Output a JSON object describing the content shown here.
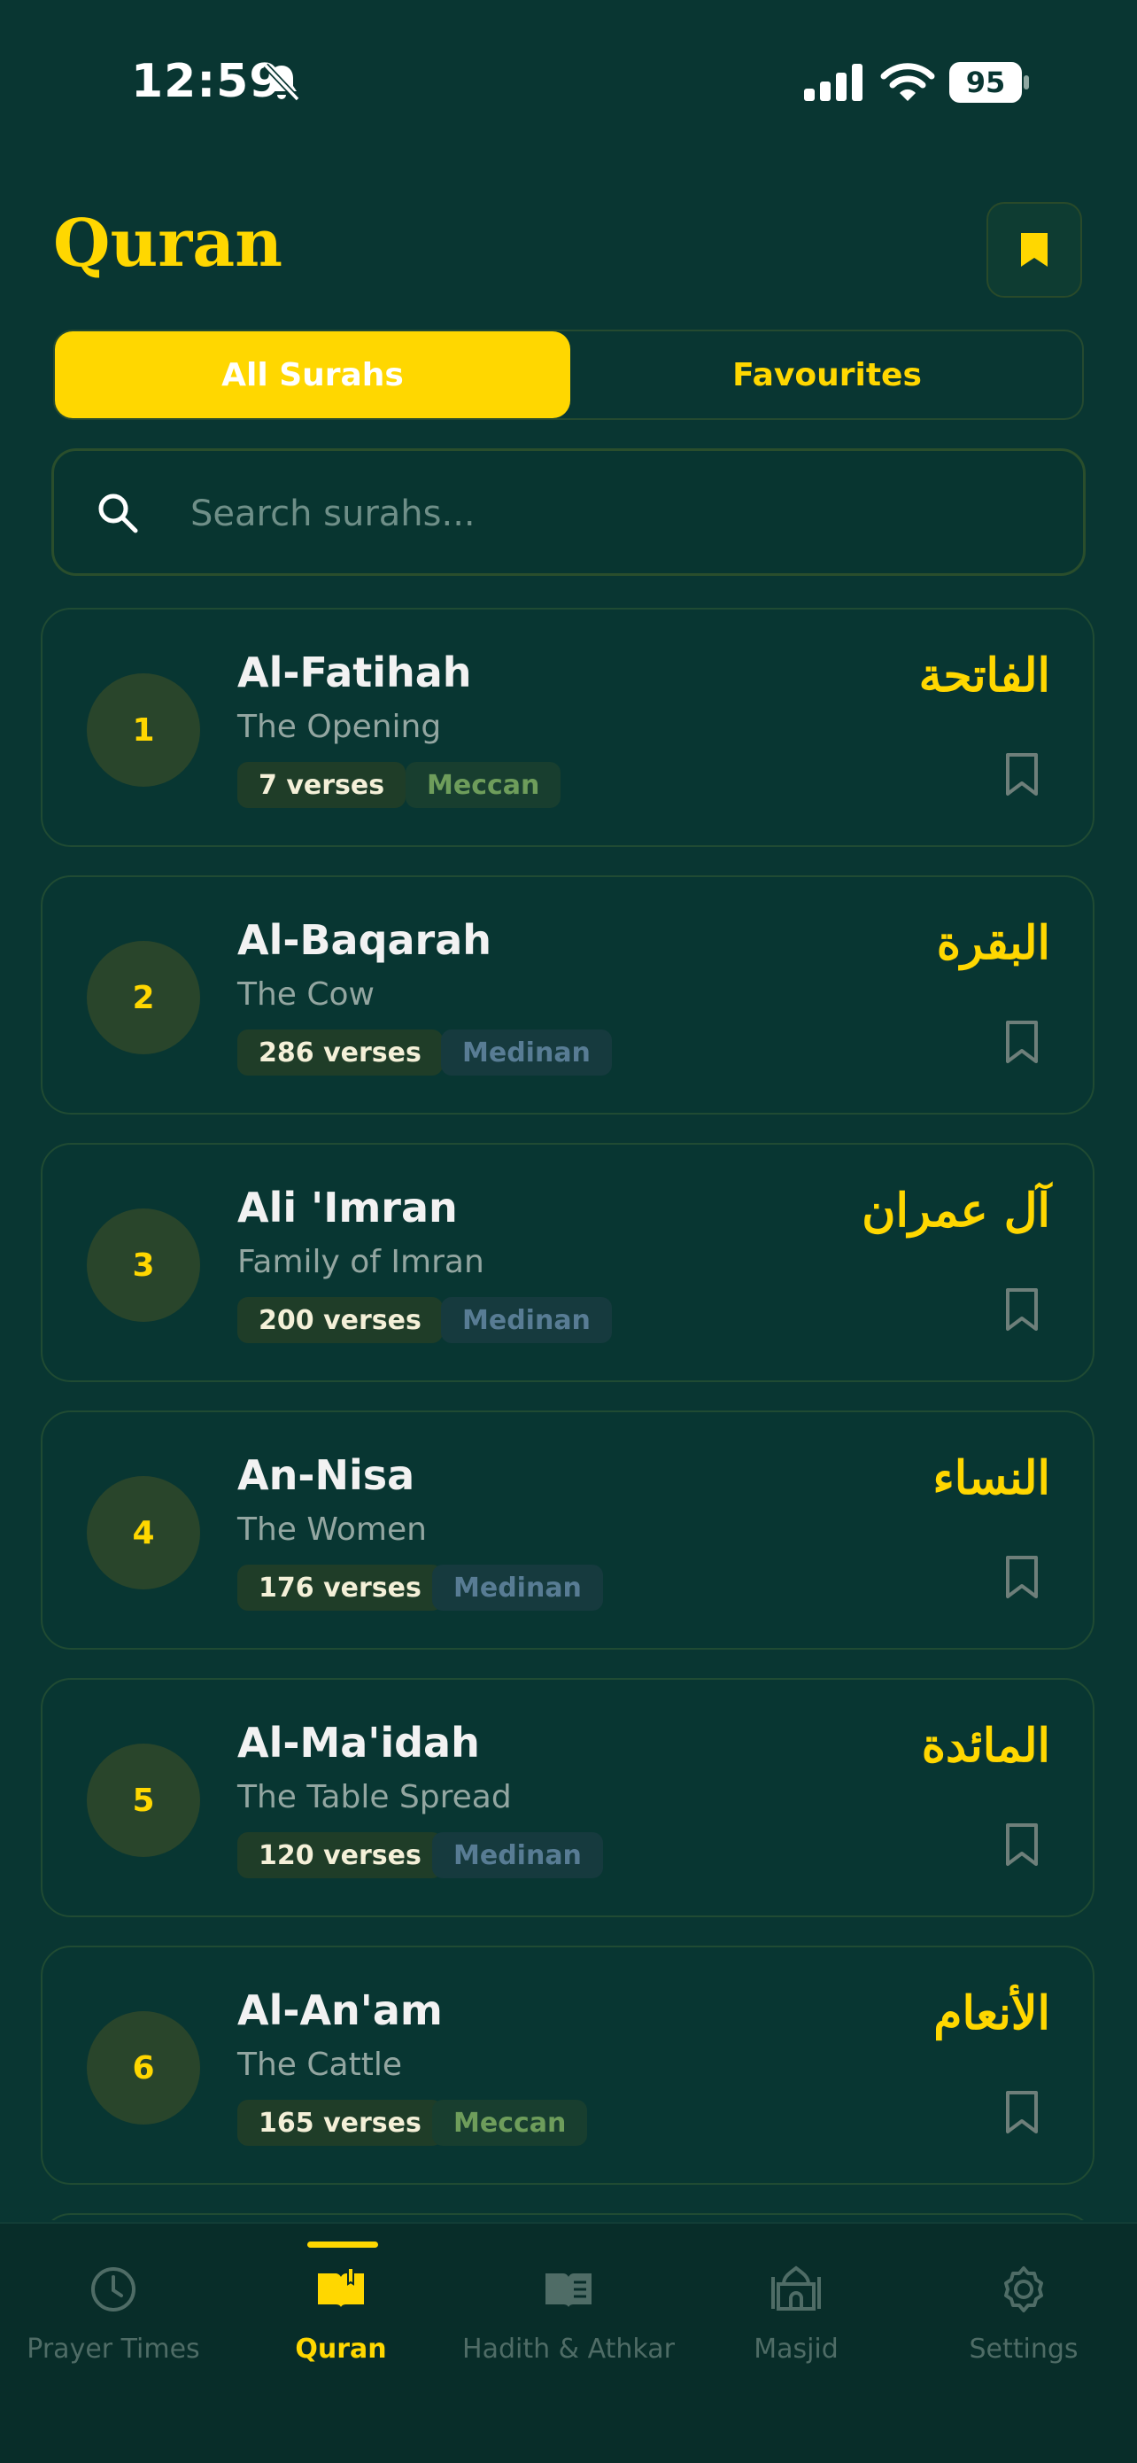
{
  "status": {
    "time": "12:59",
    "battery": "95"
  },
  "header": {
    "title": "Quran"
  },
  "tabs": [
    {
      "label": "All Surahs"
    },
    {
      "label": "Favourites"
    }
  ],
  "search": {
    "placeholder": "Search surahs..."
  },
  "surahs": [
    {
      "number": "1",
      "name": "Al-Fatihah",
      "meaning": "The Opening",
      "verses": "7 verses",
      "type": "Meccan",
      "arabic": "الفاتحة"
    },
    {
      "number": "2",
      "name": "Al-Baqarah",
      "meaning": "The Cow",
      "verses": "286 verses",
      "type": "Medinan",
      "arabic": "البقرة"
    },
    {
      "number": "3",
      "name": "Ali 'Imran",
      "meaning": "Family of Imran",
      "verses": "200 verses",
      "type": "Medinan",
      "arabic": "آل عمران"
    },
    {
      "number": "4",
      "name": "An-Nisa",
      "meaning": "The Women",
      "verses": "176 verses",
      "type": "Medinan",
      "arabic": "النساء"
    },
    {
      "number": "5",
      "name": "Al-Ma'idah",
      "meaning": "The Table Spread",
      "verses": "120 verses",
      "type": "Medinan",
      "arabic": "المائدة"
    },
    {
      "number": "6",
      "name": "Al-An'am",
      "meaning": "The Cattle",
      "verses": "165 verses",
      "type": "Meccan",
      "arabic": "الأنعام"
    }
  ],
  "nav": [
    {
      "label": "Prayer Times",
      "icon": "clock-icon"
    },
    {
      "label": "Quran",
      "icon": "open-book-icon"
    },
    {
      "label": "Hadith & Athkar",
      "icon": "book-icon"
    },
    {
      "label": "Masjid",
      "icon": "mosque-icon"
    },
    {
      "label": "Settings",
      "icon": "gear-icon"
    }
  ],
  "colors": {
    "accent": "#FFD700",
    "background": "#093632",
    "card": "#083632",
    "meccan": "#6e9d5b",
    "medinan": "#587c94"
  }
}
